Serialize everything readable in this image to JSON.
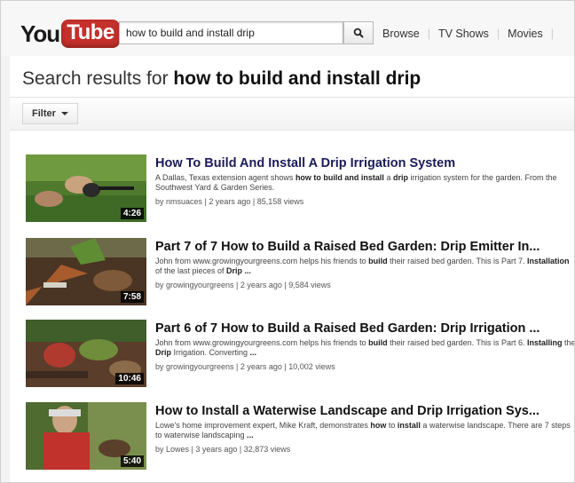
{
  "header": {
    "logo_you": "You",
    "logo_tube": "Tube",
    "search_value": "how to build and install drip",
    "nav": [
      "Browse",
      "TV Shows",
      "Movies"
    ]
  },
  "page": {
    "title_prefix": "Search results for",
    "title_query": "how to build and install drip",
    "filter_label": "Filter"
  },
  "results": [
    {
      "title": "How To Build And Install A Drip Irrigation System",
      "desc_html": "A Dallas, Texas extension agent shows <b>how to build and install</b> a <b>drip</b> irrigation system for the garden. From the Southwest Yard &amp; Garden Series.",
      "meta": "by nmsuaces | 2 years ago | 85,158 views",
      "duration": "4:26"
    },
    {
      "title": "Part 7 of 7 How to Build a Raised Bed Garden: Drip Emitter In...",
      "desc_html": "John from www.growingyourgreens.com helps his friends to <b>build</b> their raised bed garden. This is Part 7. <b>Installation</b> of the last pieces of <b>Drip ...</b>",
      "meta": "by growingyourgreens | 2 years ago | 9,584 views",
      "duration": "7:58"
    },
    {
      "title": "Part 6 of 7 How to Build a Raised Bed Garden: Drip Irrigation ...",
      "desc_html": "John from www.growingyourgreens.com helps his friends to <b>build</b> their raised bed garden. This is Part 6. <b>Installing</b> the <b>Drip</b> Irrigation. Converting <b>...</b>",
      "meta": "by growingyourgreens | 2 years ago | 10,002 views",
      "duration": "10:46"
    },
    {
      "title": "How to Install a Waterwise Landscape and Drip Irrigation Sys...",
      "desc_html": "Lowe's home improvement expert, Mike Kraft, demonstrates <b>how</b> to <b>install</b> a waterwise landscape. There are 7 steps to waterwise landscaping <b>...</b>",
      "meta": "by Lowes | 3 years ago | 32,873 views",
      "duration": "5:40"
    }
  ]
}
